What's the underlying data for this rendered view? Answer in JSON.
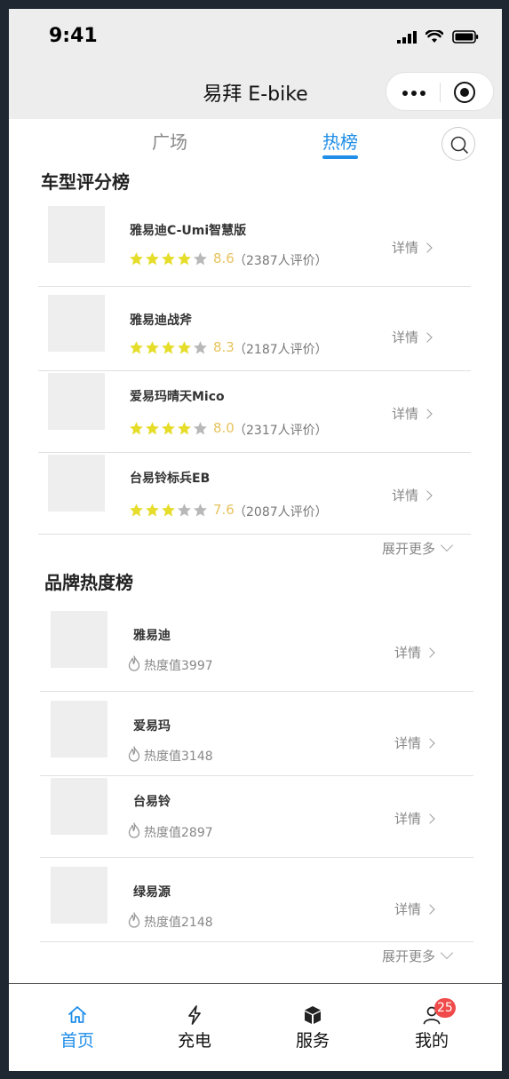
{
  "status_bar": {
    "time": "9:41"
  },
  "nav": {
    "title": "易拜 E-bike"
  },
  "tabs": [
    {
      "label": "广场",
      "active": false
    },
    {
      "label": "热榜",
      "active": true
    }
  ],
  "model_ranking": {
    "title": "车型评分榜",
    "items": [
      {
        "name": "雅易迪C-Umi智慧版",
        "stars": 4,
        "score": "8.6",
        "count": "（2387人评价）",
        "detail": "详情"
      },
      {
        "name": "雅易迪战斧",
        "stars": 4,
        "score": "8.3",
        "count": "（2187人评价）",
        "detail": "详情"
      },
      {
        "name": "爱易玛晴天Mico",
        "stars": 4,
        "score": "8.0",
        "count": "（2317人评价）",
        "detail": "详情"
      },
      {
        "name": "台易铃标兵EB",
        "stars": 3,
        "score": "7.6",
        "count": "（2087人评价）",
        "detail": "详情"
      }
    ],
    "more_label": "展开更多"
  },
  "brand_ranking": {
    "title": "品牌热度榜",
    "items": [
      {
        "name": "雅易迪",
        "heat": "热度值3997",
        "detail": "详情"
      },
      {
        "name": "爱易玛",
        "heat": "热度值3148",
        "detail": "详情"
      },
      {
        "name": "台易铃",
        "heat": "热度值2897",
        "detail": "详情"
      },
      {
        "name": "绿易源",
        "heat": "热度值2148",
        "detail": "详情"
      }
    ],
    "more_label": "展开更多"
  },
  "tabbar": [
    {
      "label": "首页",
      "icon": "home-icon",
      "active": true
    },
    {
      "label": "充电",
      "icon": "lightning-icon",
      "active": false
    },
    {
      "label": "服务",
      "icon": "cube-icon",
      "active": false
    },
    {
      "label": "我的",
      "icon": "user-icon",
      "active": false,
      "badge": "25"
    }
  ],
  "colors": {
    "accent": "#1f8ee8",
    "star": "#e6dd2a",
    "star_off": "#b8b8b8",
    "score": "#e7c35d",
    "badge": "#f04a4a"
  }
}
